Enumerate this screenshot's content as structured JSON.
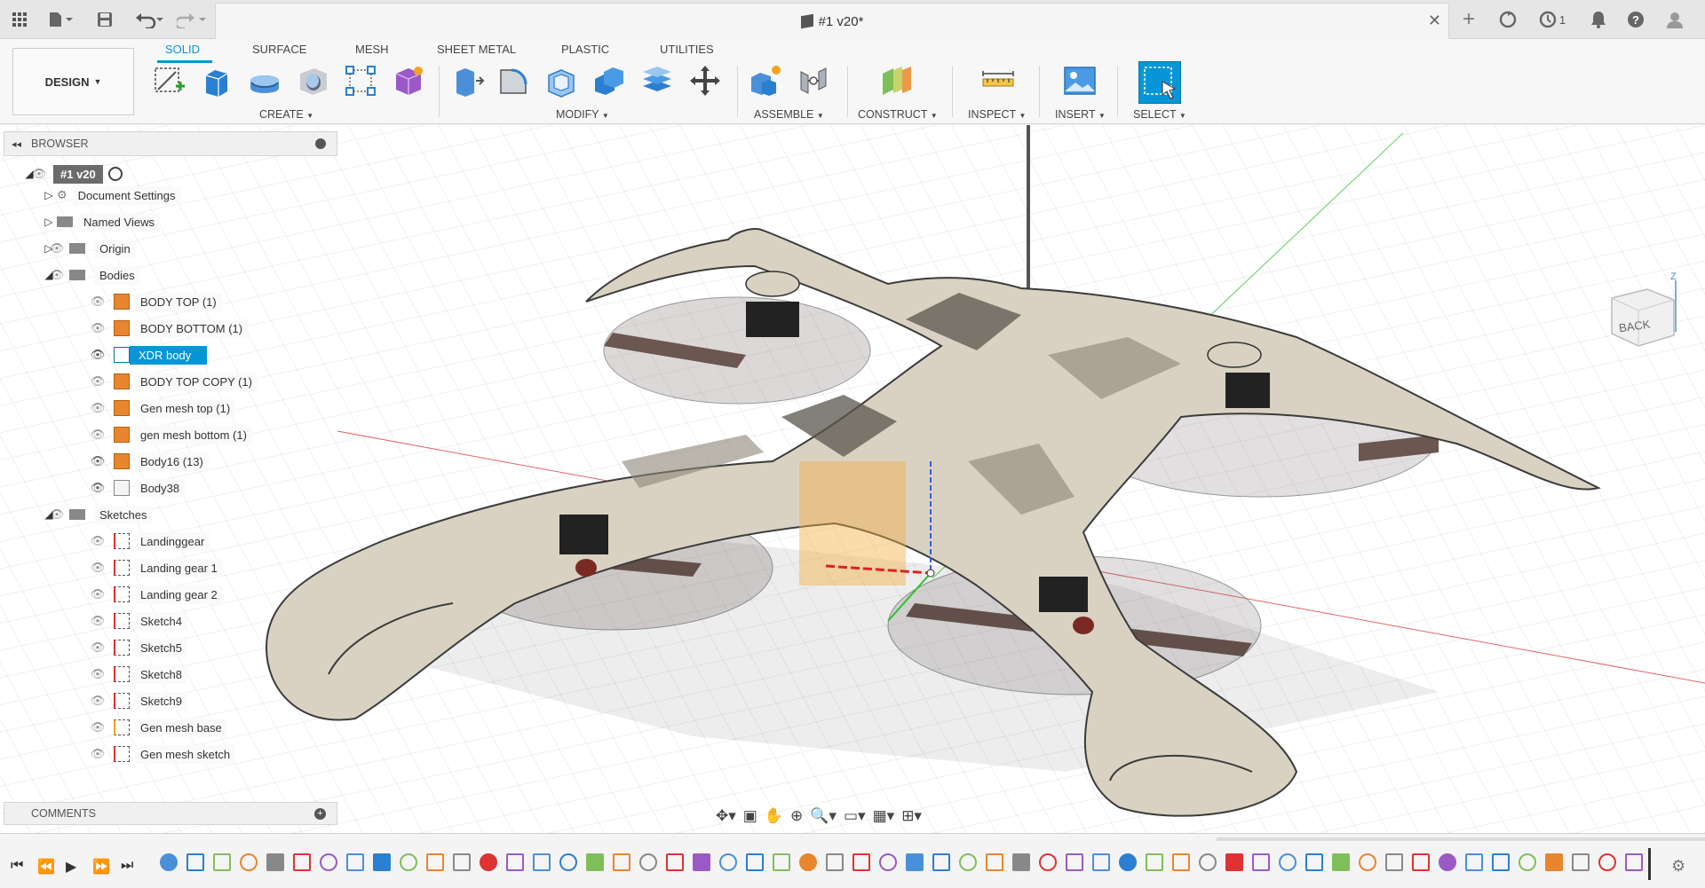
{
  "titlebar": {
    "document_title": "#1 v20*",
    "notifications_count": "1"
  },
  "ribbon": {
    "workspace_label": "DESIGN",
    "tabs": [
      "SOLID",
      "SURFACE",
      "MESH",
      "SHEET METAL",
      "PLASTIC",
      "UTILITIES"
    ],
    "active_tab": "SOLID",
    "groups": [
      "CREATE",
      "MODIFY",
      "ASSEMBLE",
      "CONSTRUCT",
      "INSPECT",
      "INSERT",
      "SELECT"
    ]
  },
  "browser": {
    "title": "BROWSER",
    "root": "#1 v20",
    "items": [
      {
        "label": "Document Settings"
      },
      {
        "label": "Named Views"
      },
      {
        "label": "Origin"
      },
      {
        "label": "Bodies"
      },
      {
        "label": "BODY TOP (1)"
      },
      {
        "label": "BODY BOTTOM (1)"
      },
      {
        "label": "XDR body"
      },
      {
        "label": "BODY TOP COPY (1)"
      },
      {
        "label": "Gen mesh top (1)"
      },
      {
        "label": "gen mesh bottom (1)"
      },
      {
        "label": "Body16 (13)"
      },
      {
        "label": "Body38"
      },
      {
        "label": "Sketches"
      },
      {
        "label": "Landinggear"
      },
      {
        "label": "Landing gear 1"
      },
      {
        "label": "Landing gear 2"
      },
      {
        "label": "Sketch4"
      },
      {
        "label": "Sketch5"
      },
      {
        "label": "Sketch8"
      },
      {
        "label": "Sketch9"
      },
      {
        "label": "Gen mesh base"
      },
      {
        "label": "Gen mesh sketch"
      }
    ],
    "selected_item": "XDR body"
  },
  "comments": {
    "title": "COMMENTS"
  },
  "viewcube": {
    "face_label": "BACK",
    "axis_label": "Z"
  },
  "colors": {
    "accent": "#0696d7",
    "body": "#d9d2c3",
    "edge": "#3b3b3b"
  }
}
